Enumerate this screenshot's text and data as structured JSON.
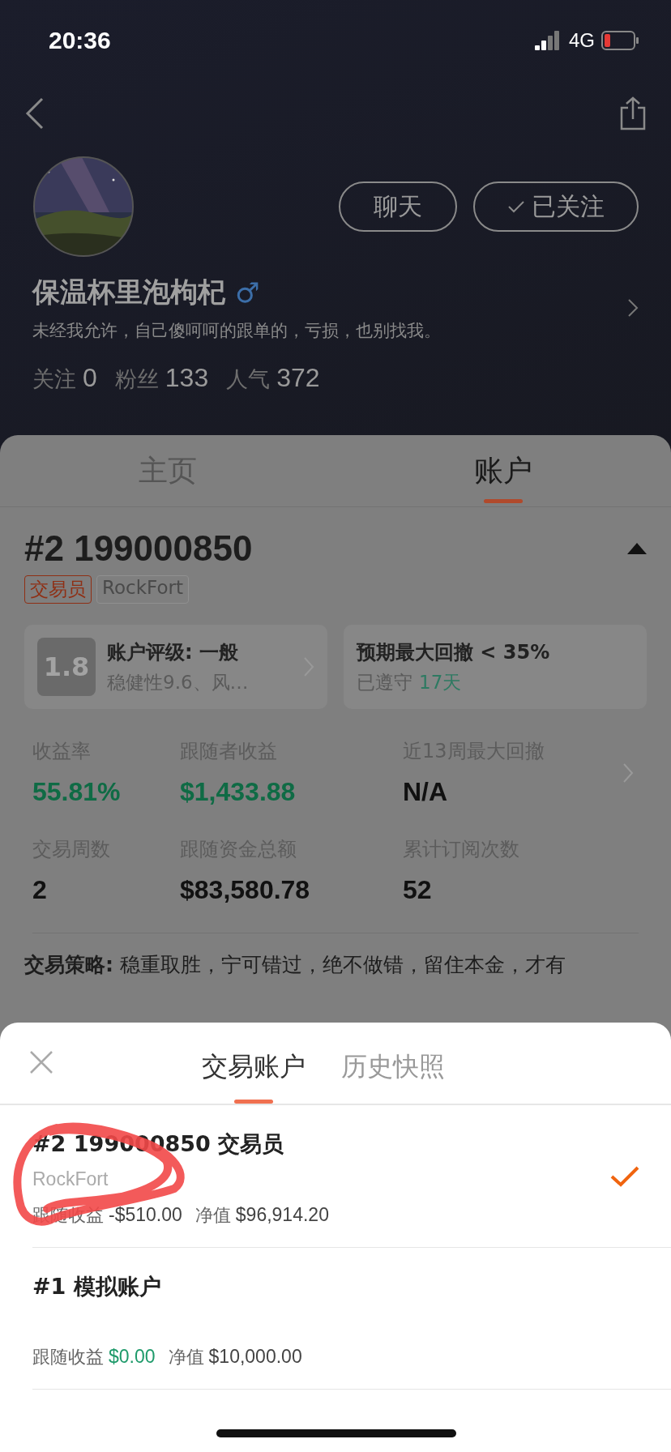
{
  "status_bar": {
    "time": "20:36",
    "network": "4G"
  },
  "profile": {
    "name": "保温杯里泡枸杞",
    "gender_symbol": "♂",
    "bio": "未经我允许，自己傻呵呵的跟单的，亏损，也别找我。",
    "buttons": [
      {
        "label": "聊天",
        "kind": "plain"
      },
      {
        "label": "已关注",
        "kind": "followed"
      }
    ],
    "stats": [
      {
        "label": "关注",
        "value": "0"
      },
      {
        "label": "粉丝",
        "value": "133"
      },
      {
        "label": "人气",
        "value": "372"
      }
    ]
  },
  "tabs": [
    {
      "label": "主页",
      "selected": false
    },
    {
      "label": "账户",
      "selected": true
    }
  ],
  "account": {
    "title": "#2 199000850",
    "expanded": true,
    "tags": [
      {
        "label": "交易员",
        "kind": "role"
      },
      {
        "label": "RockFort",
        "kind": "broker"
      }
    ],
    "rating_card": {
      "score": "1.8",
      "title": "账户评级: 一般",
      "subtitle": "稳健性9.6、风…"
    },
    "drawdown_card": {
      "title": "预期最大回撤 < 35%",
      "label": "已遵守",
      "days": "17天"
    },
    "metric_rows": [
      {
        "chevron": true,
        "items": [
          {
            "label": "收益率",
            "value": "55.81%",
            "highlight": true
          },
          {
            "label": "跟随者收益",
            "value": "$1,433.88",
            "highlight": true
          },
          {
            "label": "近13周最大回撤",
            "value": "N/A",
            "highlight": false
          }
        ]
      },
      {
        "items": [
          {
            "label": "交易周数",
            "value": "2",
            "highlight": false
          },
          {
            "label": "跟随资金总额",
            "value": "$83,580.78",
            "highlight": false
          },
          {
            "label": "累计订阅次数",
            "value": "52",
            "highlight": false
          }
        ]
      }
    ],
    "strategy": "**交易策略:** 稳重取胜，宁可错过，绝不做错，留住本金，才有"
  },
  "sheet": {
    "tabs": [
      {
        "label": "交易账户",
        "selected": true
      },
      {
        "label": "历史快照",
        "selected": false
      }
    ],
    "accounts": [
      {
        "title": "#2 199000850 交易员",
        "subtitle": "RockFort",
        "selected": true,
        "stats": [
          {
            "label": "跟随收益",
            "value": "-$510.00",
            "highlight": false
          },
          {
            "label": "净值",
            "value": "$96,914.20",
            "highlight": false
          }
        ]
      },
      {
        "title": "#1 模拟账户",
        "selected": false,
        "stats": [
          {
            "label": "跟随收益",
            "value": "$0.00",
            "highlight": true
          },
          {
            "label": "净值",
            "value": "$10,000.00",
            "highlight": false
          }
        ]
      }
    ]
  }
}
